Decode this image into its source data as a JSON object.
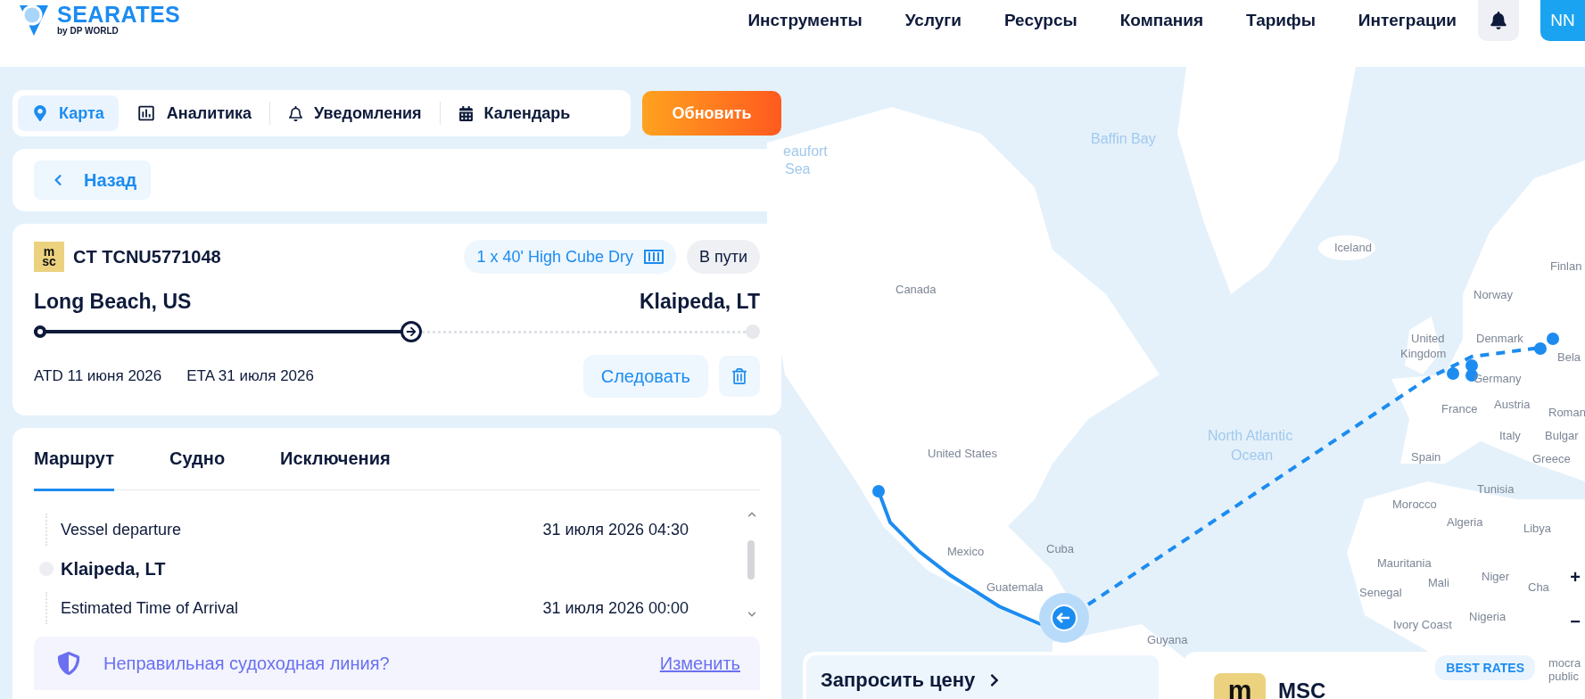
{
  "header": {
    "logo": {
      "name": "SEARATES",
      "tagline": "by DP WORLD"
    },
    "nav": [
      "Инструменты",
      "Услуги",
      "Ресурсы",
      "Компания",
      "Тарифы",
      "Интеграции"
    ],
    "avatar": "NN"
  },
  "toolbar": {
    "items": [
      {
        "label": "Карта",
        "selected": true
      },
      {
        "label": "Аналитика",
        "selected": false
      },
      {
        "label": "Уведомления",
        "selected": false
      },
      {
        "label": "Календарь",
        "selected": false
      }
    ],
    "update_button": "Обновить"
  },
  "back_button": "Назад",
  "shipment": {
    "carrier_logo": [
      "m",
      "sc"
    ],
    "container_id": "CT TCNU5771048",
    "container_type": "1 x 40' High Cube Dry",
    "status": "В пути",
    "origin": "Long Beach, US",
    "destination": "Klaipeda, LT",
    "level": 0.52,
    "atd": "ATD 11 июня 2026",
    "eta": "ETA 31 июля 2026",
    "follow_button": "Следовать"
  },
  "details": {
    "tabs": [
      {
        "label": "Маршрут",
        "selected": true
      },
      {
        "label": "Судно",
        "selected": false
      },
      {
        "label": "Исключения",
        "selected": false
      }
    ],
    "timeline": [
      {
        "kind": "event",
        "label": "Vessel departure",
        "time": "31 июля 2026 04:30"
      },
      {
        "kind": "port",
        "label": "Klaipeda, LT"
      },
      {
        "kind": "event",
        "label": "Estimated Time of Arrival",
        "time": "31 июля 2026 00:00"
      }
    ],
    "alert": {
      "text": "Неправильная судоходная линия?",
      "link": "Изменить"
    }
  },
  "map": {
    "labels": [
      {
        "text": "Baffin Bay",
        "kind": "water"
      },
      {
        "text": "eaufort",
        "kind": "water"
      },
      {
        "text": "Sea",
        "kind": "water"
      },
      {
        "text": "Iceland",
        "kind": "country"
      },
      {
        "text": "Finlan",
        "kind": "country"
      },
      {
        "text": "Canada",
        "kind": "country"
      },
      {
        "text": "Norway",
        "kind": "country"
      },
      {
        "text": "United",
        "kind": "country"
      },
      {
        "text": "Denmark",
        "kind": "country"
      },
      {
        "text": "Kingdom",
        "kind": "country"
      },
      {
        "text": "Bela",
        "kind": "country"
      },
      {
        "text": "Germany",
        "kind": "country"
      },
      {
        "text": "France",
        "kind": "country"
      },
      {
        "text": "Austria",
        "kind": "country"
      },
      {
        "text": "Roman",
        "kind": "country"
      },
      {
        "text": "North Atlantic",
        "kind": "water"
      },
      {
        "text": "Italy",
        "kind": "country"
      },
      {
        "text": "Bulgar",
        "kind": "country"
      },
      {
        "text": "United States",
        "kind": "country"
      },
      {
        "text": "Ocean",
        "kind": "water"
      },
      {
        "text": "Spain",
        "kind": "country"
      },
      {
        "text": "Greece",
        "kind": "country"
      },
      {
        "text": "Tunisia",
        "kind": "country"
      },
      {
        "text": "Morocco",
        "kind": "country"
      },
      {
        "text": "Algeria",
        "kind": "country"
      },
      {
        "text": "Libya",
        "kind": "country"
      },
      {
        "text": "Mexico",
        "kind": "country"
      },
      {
        "text": "Cuba",
        "kind": "country"
      },
      {
        "text": "Mauritania",
        "kind": "country"
      },
      {
        "text": "Guatemala",
        "kind": "country"
      },
      {
        "text": "Senegal",
        "kind": "country"
      },
      {
        "text": "Mali",
        "kind": "country"
      },
      {
        "text": "Niger",
        "kind": "country"
      },
      {
        "text": "Cha",
        "kind": "country"
      },
      {
        "text": "Ivory Coast",
        "kind": "country"
      },
      {
        "text": "Nigeria",
        "kind": "country"
      },
      {
        "text": "Guyana",
        "kind": "country"
      },
      {
        "text": "mocra",
        "kind": "country"
      },
      {
        "text": "public",
        "kind": "country"
      }
    ],
    "zoom_in": "+",
    "zoom_out": "−"
  },
  "quote_card": {
    "title": "Запросить цену"
  },
  "rate_card": {
    "badge": "BEST RATES",
    "logo": "m",
    "carrier": "MSC"
  }
}
